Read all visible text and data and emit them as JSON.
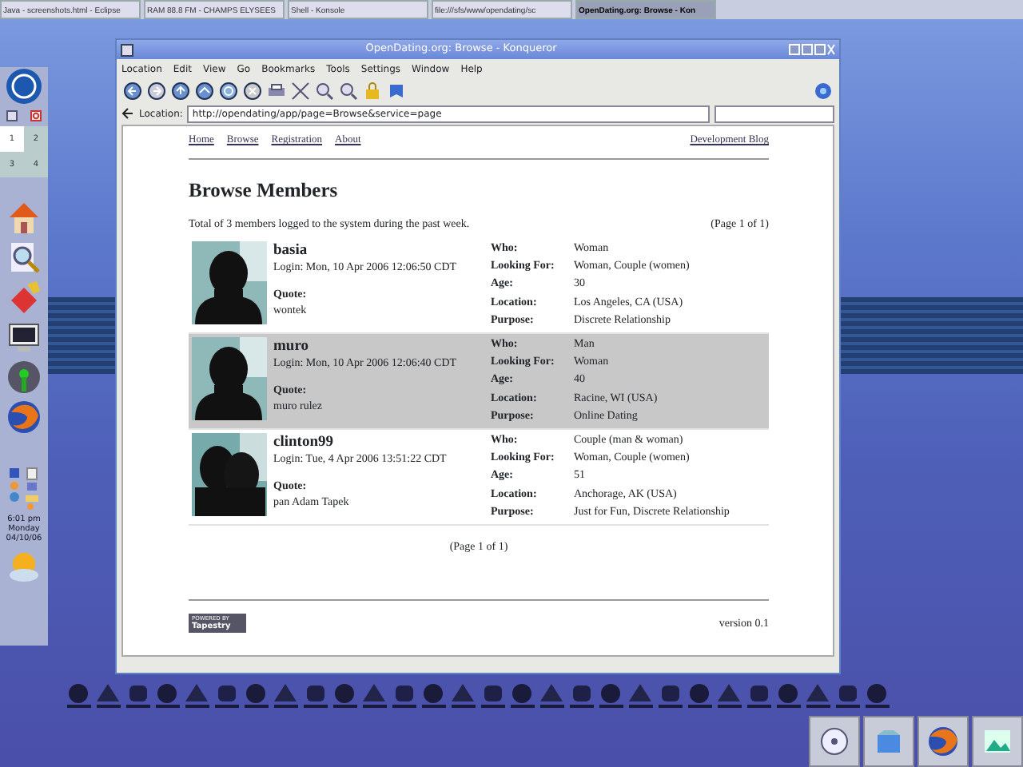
{
  "taskbar": {
    "tasks": [
      {
        "title": "Java - screenshots.html - Eclipse",
        "selected": false
      },
      {
        "title": "RAM 88.8 FM - CHAMPS ELYSEES",
        "selected": false
      },
      {
        "title": "Shell - Konsole",
        "selected": false
      },
      {
        "title": "file:///sfs/www/opendating/sc",
        "selected": false
      },
      {
        "title": "OpenDating.org: Browse - Kon",
        "selected": true
      }
    ]
  },
  "pager": {
    "desktops": [
      {
        "label": "1",
        "selected": true
      },
      {
        "label": "2",
        "selected": false
      },
      {
        "label": "3",
        "selected": false
      },
      {
        "label": "4",
        "selected": false
      }
    ]
  },
  "clock": {
    "time": "6:01 pm",
    "day": "Monday",
    "date": "04/10/06"
  },
  "window": {
    "title": "OpenDating.org: Browse - Konqueror",
    "menu": [
      "Location",
      "Edit",
      "View",
      "Go",
      "Bookmarks",
      "Tools",
      "Settings",
      "Window",
      "Help"
    ],
    "location_label": "Location:",
    "url": "http://opendating/app/page=Browse&service=page"
  },
  "page": {
    "nav": [
      "Home",
      "Browse",
      "Registration",
      "About"
    ],
    "nav_right": "Development Blog",
    "heading": "Browse Members",
    "summary": "Total of 3 members logged to the system during the past week.",
    "page_info": "(Page 1 of 1)",
    "members": [
      {
        "username": "basia",
        "login": "Login: Mon, 10 Apr 2006 12:06:50 CDT",
        "quote_label": "Quote:",
        "quote": "wontek",
        "highlighted": false,
        "details": [
          {
            "label": "Who:",
            "value": "Woman"
          },
          {
            "label": "Looking For:",
            "value": "Woman, Couple (women)"
          },
          {
            "label": "Age:",
            "value": "30"
          },
          {
            "label": "Location:",
            "value": "Los Angeles, CA (USA)"
          },
          {
            "label": "Purpose:",
            "value": "Discrete Relationship"
          }
        ]
      },
      {
        "username": "muro",
        "login": "Login: Mon, 10 Apr 2006 12:06:40 CDT",
        "quote_label": "Quote:",
        "quote": "muro rulez",
        "highlighted": true,
        "details": [
          {
            "label": "Who:",
            "value": "Man"
          },
          {
            "label": "Looking For:",
            "value": "Woman"
          },
          {
            "label": "Age:",
            "value": "40"
          },
          {
            "label": "Location:",
            "value": "Racine, WI (USA)"
          },
          {
            "label": "Purpose:",
            "value": "Online Dating"
          }
        ]
      },
      {
        "username": "clinton99",
        "login": "Login: Tue, 4 Apr 2006 13:51:22 CDT",
        "quote_label": "Quote:",
        "quote": "pan Adam Tapek",
        "highlighted": false,
        "details": [
          {
            "label": "Who:",
            "value": "Couple (man & woman)"
          },
          {
            "label": "Looking For:",
            "value": "Woman, Couple (women)"
          },
          {
            "label": "Age:",
            "value": "51"
          },
          {
            "label": "Location:",
            "value": "Anchorage, AK (USA)"
          },
          {
            "label": "Purpose:",
            "value": "Just for Fun, Discrete Relationship"
          }
        ]
      }
    ],
    "pager_bottom": "(Page 1 of 1)",
    "badge": [
      "POWERED BY",
      "Tapestry"
    ],
    "version": "version 0.1"
  }
}
